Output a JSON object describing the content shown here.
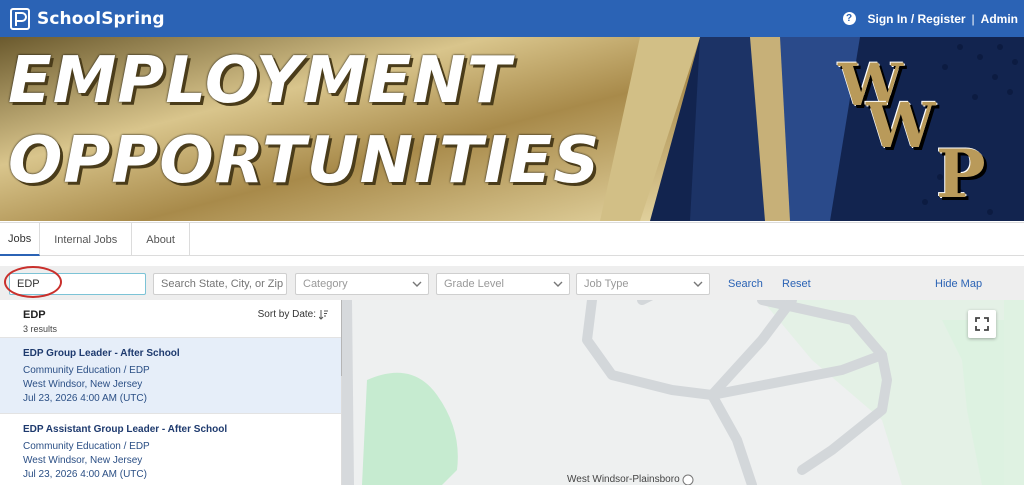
{
  "app": {
    "brand": "SchoolSpring",
    "help_icon": "question-circle-icon",
    "nav": {
      "sign_in": "Sign In / Register",
      "separator": "|",
      "admin": "Admin"
    }
  },
  "banner": {
    "line1": "EMPLOYMENT",
    "line2": "OPPORTUNITIES",
    "logo_letters": [
      "W",
      "W",
      "P"
    ]
  },
  "tabs": [
    {
      "label": "Jobs",
      "active": true
    },
    {
      "label": "Internal Jobs",
      "active": false
    },
    {
      "label": "About",
      "active": false
    }
  ],
  "filters": {
    "keyword_value": "EDP",
    "location_placeholder": "Search State, City, or Zip",
    "category": "Category",
    "grade_level": "Grade Level",
    "job_type": "Job Type",
    "search": "Search",
    "reset": "Reset",
    "hide_map": "Hide Map"
  },
  "results": {
    "term": "EDP",
    "count": "3 results",
    "sort_label": "Sort by Date:",
    "jobs": [
      {
        "title": "EDP Group Leader - After School",
        "department": "Community Education / EDP",
        "location": "West Windsor, New Jersey",
        "date": "Jul 23, 2026 4:00 AM (UTC)"
      },
      {
        "title": "EDP Assistant Group Leader - After School",
        "department": "Community Education / EDP",
        "location": "West Windsor, New Jersey",
        "date": "Jul 23, 2026 4:00 AM (UTC)"
      }
    ]
  },
  "map": {
    "label": "West Windsor-Plainsboro",
    "fullscreen_icon": "fullscreen-icon",
    "colors": {
      "road": "#d6d9dc",
      "park": "#c6ebd0",
      "base": "#eef0f0"
    }
  },
  "colors": {
    "brand_blue": "#2b63b5",
    "gold": "#b99a5a",
    "navy": "#12244f",
    "annotation_red": "#c9302c"
  }
}
